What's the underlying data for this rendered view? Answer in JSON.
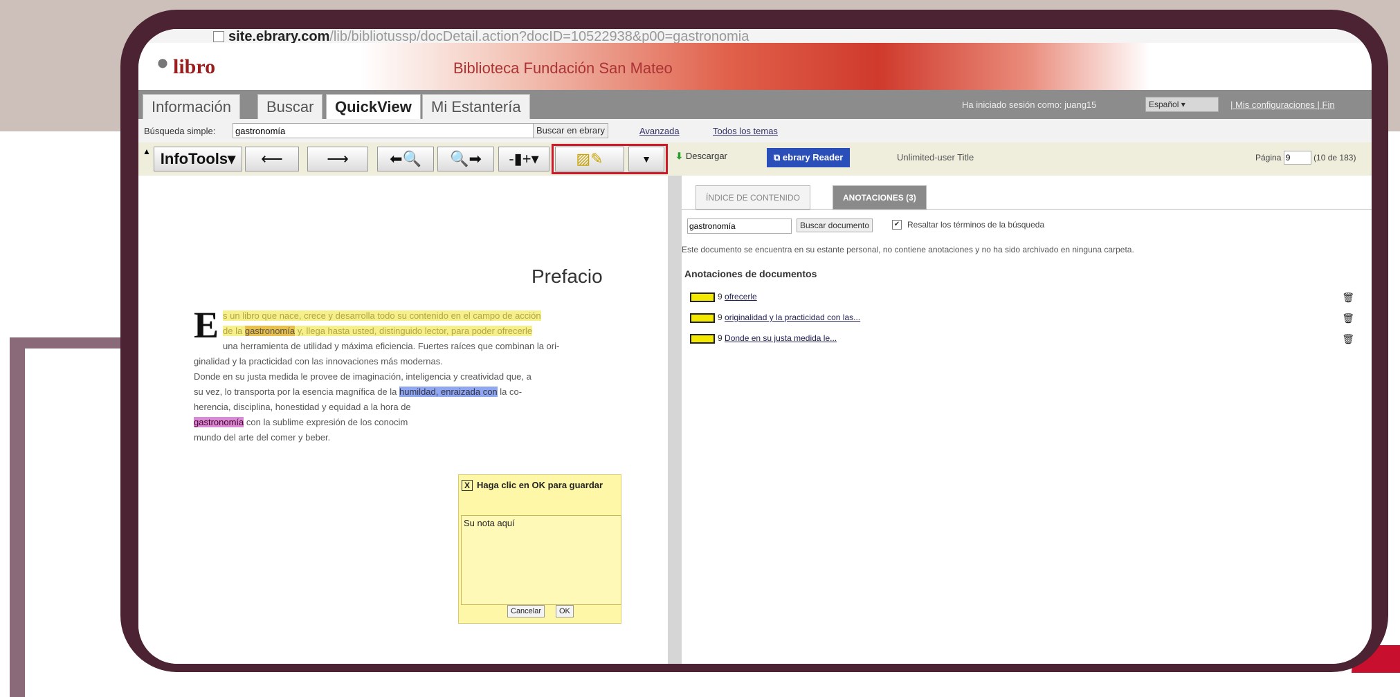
{
  "url": {
    "host": "site.ebrary.com",
    "path": "/lib/bibliotussp/docDetail.action?docID=10522938&p00=gastronomia"
  },
  "logo": "libro",
  "library_title": "Biblioteca Fundación San Mateo",
  "tabs": [
    "Información",
    "Buscar",
    "QuickView",
    "Mi Estantería"
  ],
  "session": {
    "text": "Ha iniciado sesión como: juang15",
    "language": "Español",
    "settings": "Mis configuraciones",
    "sep": "|",
    "finish": "| Fin"
  },
  "search": {
    "label": "Búsqueda simple:",
    "value": "gastronomía",
    "button": "Buscar en ebrary",
    "advanced": "Avanzada",
    "topics": "Todos los temas"
  },
  "toolbar": {
    "infotools": "InfoTools",
    "download": "Descargar",
    "reader": "ebrary Reader",
    "unlimited": "Unlimited-user Title",
    "page_label": "Página",
    "page_value": "9",
    "page_total": "(10 de 183)"
  },
  "doc": {
    "title": "Prefacio",
    "dropcap": "E",
    "l1": "s un libro que nace, crece y desarrolla todo su contenido en el campo de acción",
    "l2a": "de la ",
    "l2b": "gastronomía",
    "l2c": " y, llega hasta usted, distinguido lector, para poder ofrecerle",
    "l3": "una herramienta de utilidad y máxima eficiencia. Fuertes raíces que combinan la ori-",
    "l4": "ginalidad y la practicidad con las innovaciones más modernas.",
    "l5": "Donde en su justa medida le provee de imaginación, inteligencia y creatividad que, a",
    "l6a": "su vez, lo transporta por la esencia magnífica de la ",
    "l6b": "humildad, enraizada con",
    "l6c": " la co-",
    "l7": "herencia, disciplina, honestidad y equidad a la hora de",
    "l8a": "gastronomía",
    "l8b": " con la sublime expresión de los conocim",
    "l9": "mundo del arte del comer y beber."
  },
  "note": {
    "close": "X",
    "header": "Haga clic en OK para guardar",
    "placeholder": "Su nota aquí",
    "cancel": "Cancelar",
    "ok": "OK"
  },
  "right": {
    "tabs": [
      "ÍNDICE DE CONTENIDO",
      "ANOTACIONES (3)"
    ],
    "search_value": "gastronomía",
    "search_button": "Buscar documento",
    "highlight_label": "Resaltar los términos de la búsqueda",
    "status": "Este documento se encuentra en su estante personal, no contiene anotaciones y no ha sido archivado en ninguna carpeta.",
    "annotations_title": "Anotaciones de documentos",
    "annotations": [
      {
        "page": "9",
        "text": "ofrecerle"
      },
      {
        "page": "9",
        "text": "originalidad y la practicidad con las..."
      },
      {
        "page": "9",
        "text": "Donde en su justa medida le..."
      }
    ]
  },
  "colors": {
    "frame": "#4b2333",
    "accent": "#d0182c",
    "highlight_yellow": "#f6f08a",
    "highlight_blue": "#8fa6f0",
    "highlight_pink": "#d98ad6"
  }
}
